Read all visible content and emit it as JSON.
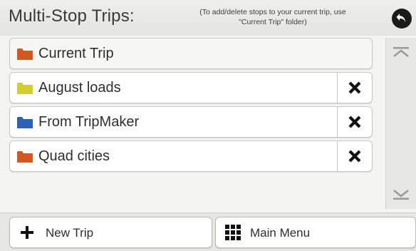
{
  "header": {
    "title": "Multi-Stop Trips:",
    "hint": "(To add/delete stops to your current trip, use \"Current Trip\" folder)",
    "back_icon": "back-arrow-icon"
  },
  "trips": [
    {
      "label": "Current Trip",
      "folder_color": "#d4571f",
      "deletable": false
    },
    {
      "label": "August loads",
      "folder_color": "#d2cf2a",
      "deletable": true
    },
    {
      "label": "From TripMaker",
      "folder_color": "#2a62b8",
      "deletable": true
    },
    {
      "label": "Quad cities",
      "folder_color": "#d4571f",
      "deletable": true
    }
  ],
  "scrollbar": {
    "up_icon": "scroll-up-icon",
    "down_icon": "scroll-down-icon"
  },
  "footer": {
    "new_trip_label": "New Trip",
    "main_menu_label": "Main Menu"
  }
}
